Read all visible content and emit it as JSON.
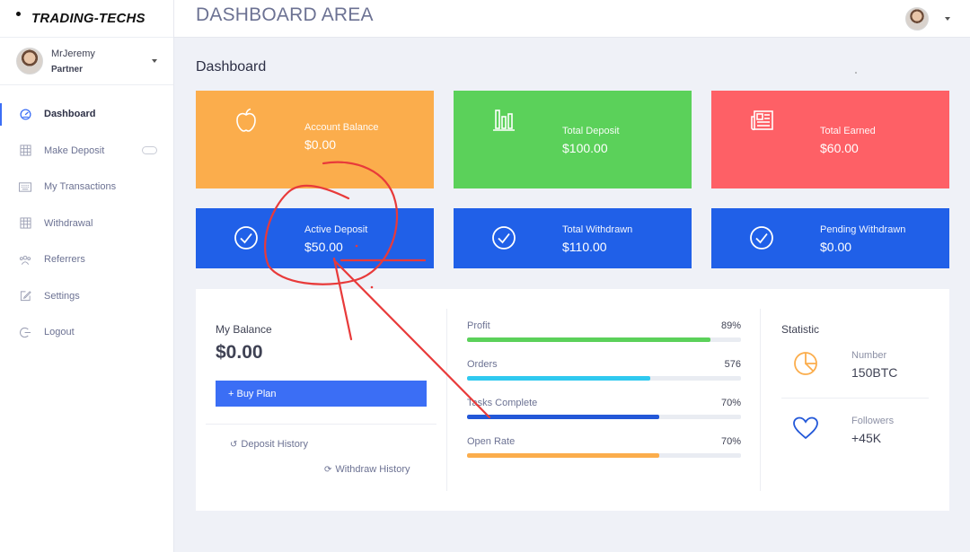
{
  "brand": {
    "name": "TRADING-TECHS"
  },
  "user": {
    "name": "MrJeremy",
    "role": "Partner"
  },
  "sidebar": {
    "items": [
      {
        "label": "Dashboard",
        "icon": "dashboard-icon",
        "active": true
      },
      {
        "label": "Make Deposit",
        "icon": "grid-icon"
      },
      {
        "label": "My Transactions",
        "icon": "keyboard-icon"
      },
      {
        "label": "Withdrawal",
        "icon": "table-icon"
      },
      {
        "label": "Referrers",
        "icon": "people-icon"
      },
      {
        "label": "Settings",
        "icon": "edit-icon"
      },
      {
        "label": "Logout",
        "icon": "logout-icon"
      }
    ]
  },
  "header": {
    "title": "DASHBOARD AREA"
  },
  "main": {
    "section_title": "Dashboard",
    "cards": [
      {
        "label": "Account Balance",
        "value": "$0.00",
        "color": "#fbad4c",
        "icon": "apple-icon"
      },
      {
        "label": "Total Deposit",
        "value": "$100.00",
        "color": "#5bd15a",
        "icon": "bar-chart-icon"
      },
      {
        "label": "Total Earned",
        "value": "$60.00",
        "color": "#fe6066",
        "icon": "newspaper-icon"
      },
      {
        "label": "Active Deposit",
        "value": "$50.00",
        "color": "#2060e8",
        "icon": "check-circle-icon"
      },
      {
        "label": "Total Withdrawn",
        "value": "$110.00",
        "color": "#2060e8",
        "icon": "check-circle-icon"
      },
      {
        "label": "Pending Withdrawn",
        "value": "$0.00",
        "color": "#2060e8",
        "icon": "check-circle-icon"
      }
    ]
  },
  "balance": {
    "label": "My Balance",
    "value": "$0.00",
    "buy_label": "+ Buy Plan",
    "deposit_history": "Deposit History",
    "withdraw_history": "Withdraw History"
  },
  "progress": [
    {
      "label": "Profit",
      "value": "89%",
      "fraction": 0.89,
      "color": "#5bd15a"
    },
    {
      "label": "Orders",
      "value": "576",
      "fraction": 0.67,
      "color": "#2fc9f0"
    },
    {
      "label": "Tasks Complete",
      "value": "70%",
      "fraction": 0.7,
      "color": "#2358d8"
    },
    {
      "label": "Open Rate",
      "value": "70%",
      "fraction": 0.7,
      "color": "#fbad4c"
    }
  ],
  "statistic": {
    "title": "Statistic",
    "items": [
      {
        "label": "Number",
        "value": "150BTC",
        "icon": "pie-chart-icon",
        "color": "#fbad4c"
      },
      {
        "label": "Followers",
        "value": "+45K",
        "icon": "heart-icon",
        "color": "#2358d8"
      }
    ]
  },
  "annotation_color": "#e83a3a"
}
